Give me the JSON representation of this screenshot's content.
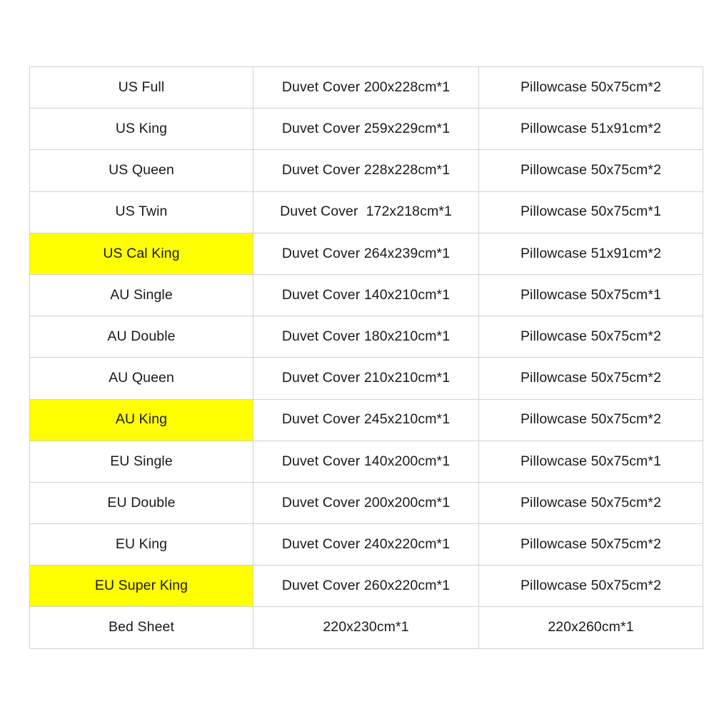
{
  "table": {
    "highlight_color": "#FFFF00",
    "border_color": "#D2D2D2",
    "background_color": "#FFFFFF",
    "text_color": "#1A1A1A",
    "rows": [
      {
        "size": "US Full",
        "duvet": "Duvet Cover 200x228cm*1",
        "pillowcase": "Pillowcase 50x75cm*2",
        "highlighted": false
      },
      {
        "size": "US King",
        "duvet": "Duvet Cover 259x229cm*1",
        "pillowcase": "Pillowcase 51x91cm*2",
        "highlighted": false
      },
      {
        "size": "US Queen",
        "duvet": "Duvet Cover 228x228cm*1",
        "pillowcase": "Pillowcase 50x75cm*2",
        "highlighted": false
      },
      {
        "size": "US Twin",
        "duvet": "Duvet Cover  172x218cm*1",
        "pillowcase": "Pillowcase 50x75cm*1",
        "highlighted": false
      },
      {
        "size": "US Cal King",
        "duvet": "Duvet Cover 264x239cm*1",
        "pillowcase": "Pillowcase 51x91cm*2",
        "highlighted": true
      },
      {
        "size": "AU Single",
        "duvet": "Duvet Cover 140x210cm*1",
        "pillowcase": "Pillowcase 50x75cm*1",
        "highlighted": false
      },
      {
        "size": "AU Double",
        "duvet": "Duvet Cover 180x210cm*1",
        "pillowcase": "Pillowcase 50x75cm*2",
        "highlighted": false
      },
      {
        "size": "AU Queen",
        "duvet": "Duvet Cover 210x210cm*1",
        "pillowcase": "Pillowcase 50x75cm*2",
        "highlighted": false
      },
      {
        "size": "AU King",
        "duvet": "Duvet Cover 245x210cm*1",
        "pillowcase": "Pillowcase 50x75cm*2",
        "highlighted": true
      },
      {
        "size": "EU Single",
        "duvet": "Duvet Cover 140x200cm*1",
        "pillowcase": "Pillowcase 50x75cm*1",
        "highlighted": false
      },
      {
        "size": "EU Double",
        "duvet": "Duvet Cover 200x200cm*1",
        "pillowcase": "Pillowcase 50x75cm*2",
        "highlighted": false
      },
      {
        "size": "EU King",
        "duvet": "Duvet Cover 240x220cm*1",
        "pillowcase": "Pillowcase 50x75cm*2",
        "highlighted": false
      },
      {
        "size": "EU Super King",
        "duvet": "Duvet Cover 260x220cm*1",
        "pillowcase": "Pillowcase 50x75cm*2",
        "highlighted": true
      },
      {
        "size": "Bed Sheet",
        "duvet": "220x230cm*1",
        "pillowcase": "220x260cm*1",
        "highlighted": false
      }
    ]
  }
}
